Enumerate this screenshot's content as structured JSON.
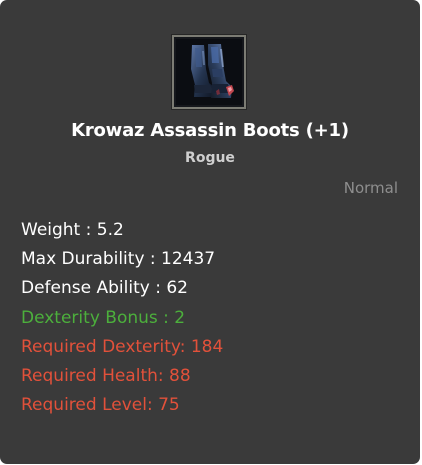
{
  "item": {
    "name": "Krowaz Assassin Boots (+1)",
    "class": "Rogue",
    "grade": "Normal",
    "icon": "boots-icon"
  },
  "stats": [
    {
      "text": "Weight : 5.2",
      "color": "#ffffff"
    },
    {
      "text": "Max Durability : 12437",
      "color": "#ffffff"
    },
    {
      "text": "Defense Ability : 62",
      "color": "#ffffff"
    },
    {
      "text": "Dexterity Bonus : 2",
      "color": "#4caf3c"
    },
    {
      "text": "Required Dexterity: 184",
      "color": "#e2513a"
    },
    {
      "text": "Required Health: 88",
      "color": "#e2513a"
    },
    {
      "text": "Required Level: 75",
      "color": "#e2513a"
    }
  ],
  "colors": {
    "background": "#3a3a3a",
    "bonus": "#4caf3c",
    "requirement": "#e2513a",
    "grade": "#8e8e8e"
  }
}
